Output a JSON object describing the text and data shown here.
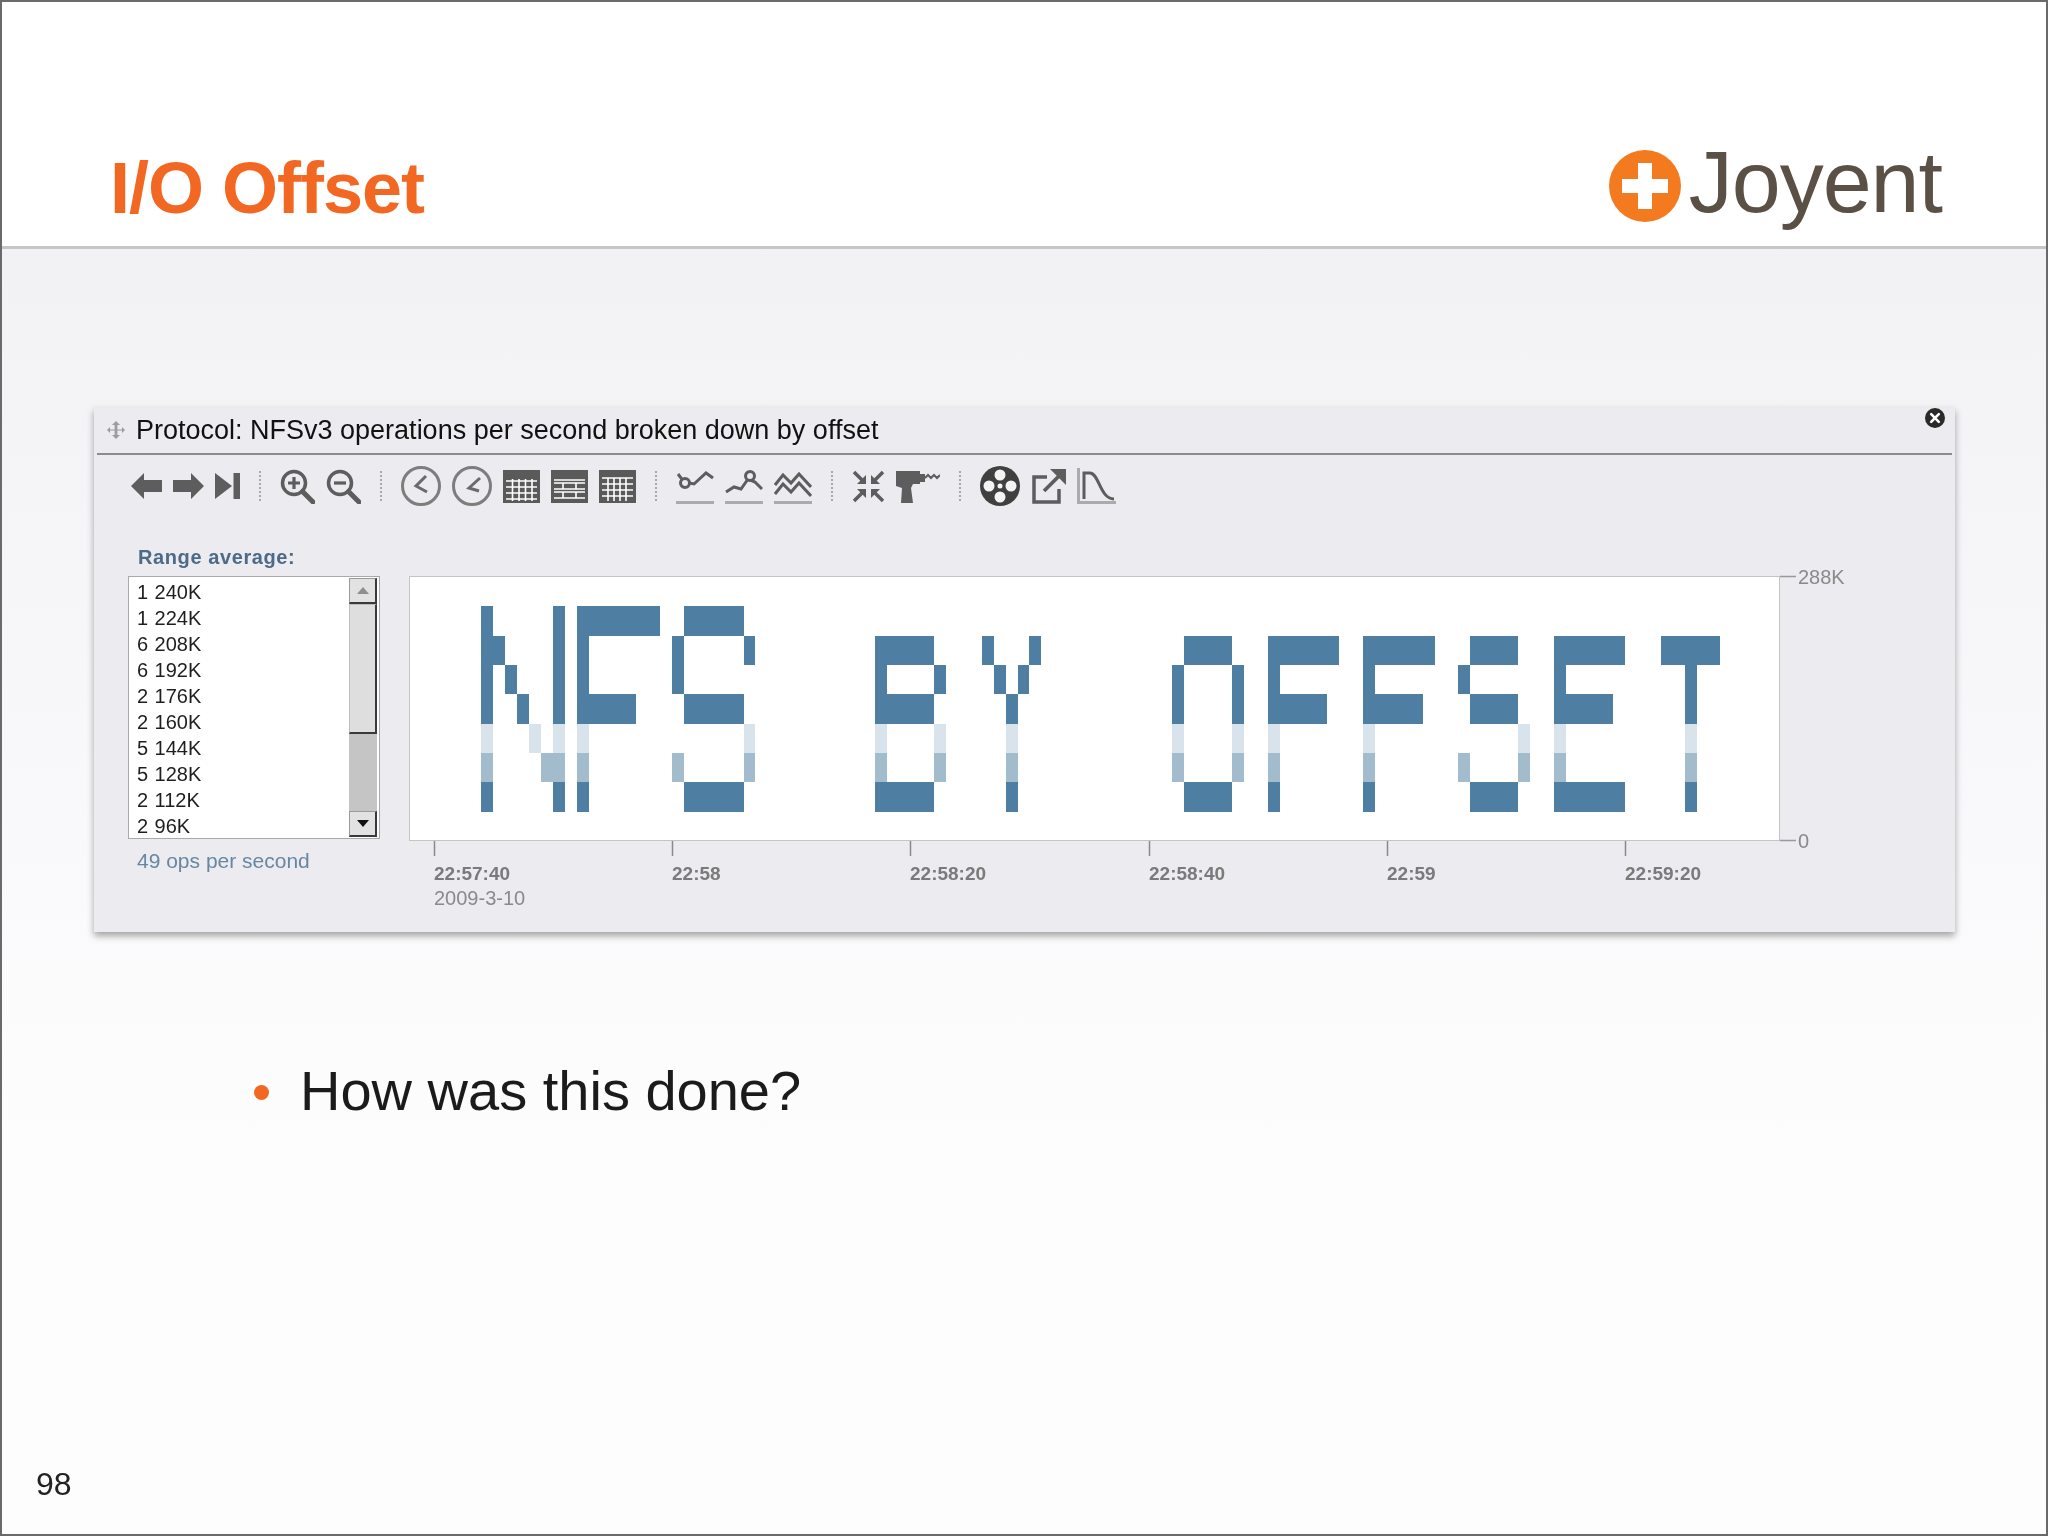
{
  "header": {
    "title": "I/O Offset",
    "logo": "Joyent"
  },
  "panel": {
    "title": "Protocol: NFSv3 operations per second broken down by offset",
    "range_label": "Range average:",
    "range_list": [
      {
        "count": "1",
        "offset": "240K"
      },
      {
        "count": "1",
        "offset": "224K"
      },
      {
        "count": "6",
        "offset": "208K"
      },
      {
        "count": "6",
        "offset": "192K"
      },
      {
        "count": "2",
        "offset": "176K"
      },
      {
        "count": "2",
        "offset": "160K"
      },
      {
        "count": "5",
        "offset": "144K"
      },
      {
        "count": "5",
        "offset": "128K"
      },
      {
        "count": "2",
        "offset": "112K"
      },
      {
        "count": "2",
        "offset": "96K"
      }
    ],
    "summary": "49 ops per second",
    "heatmap": {
      "y_axis_labels": [
        "288K",
        "0"
      ],
      "x_axis_labels": [
        "22:57:40",
        "22:58",
        "22:58:20",
        "22:58:40",
        "22:59",
        "22:59:20"
      ],
      "date": "2009-3-10"
    }
  },
  "bullets": [
    "How was this done?"
  ],
  "page_number": "98"
}
